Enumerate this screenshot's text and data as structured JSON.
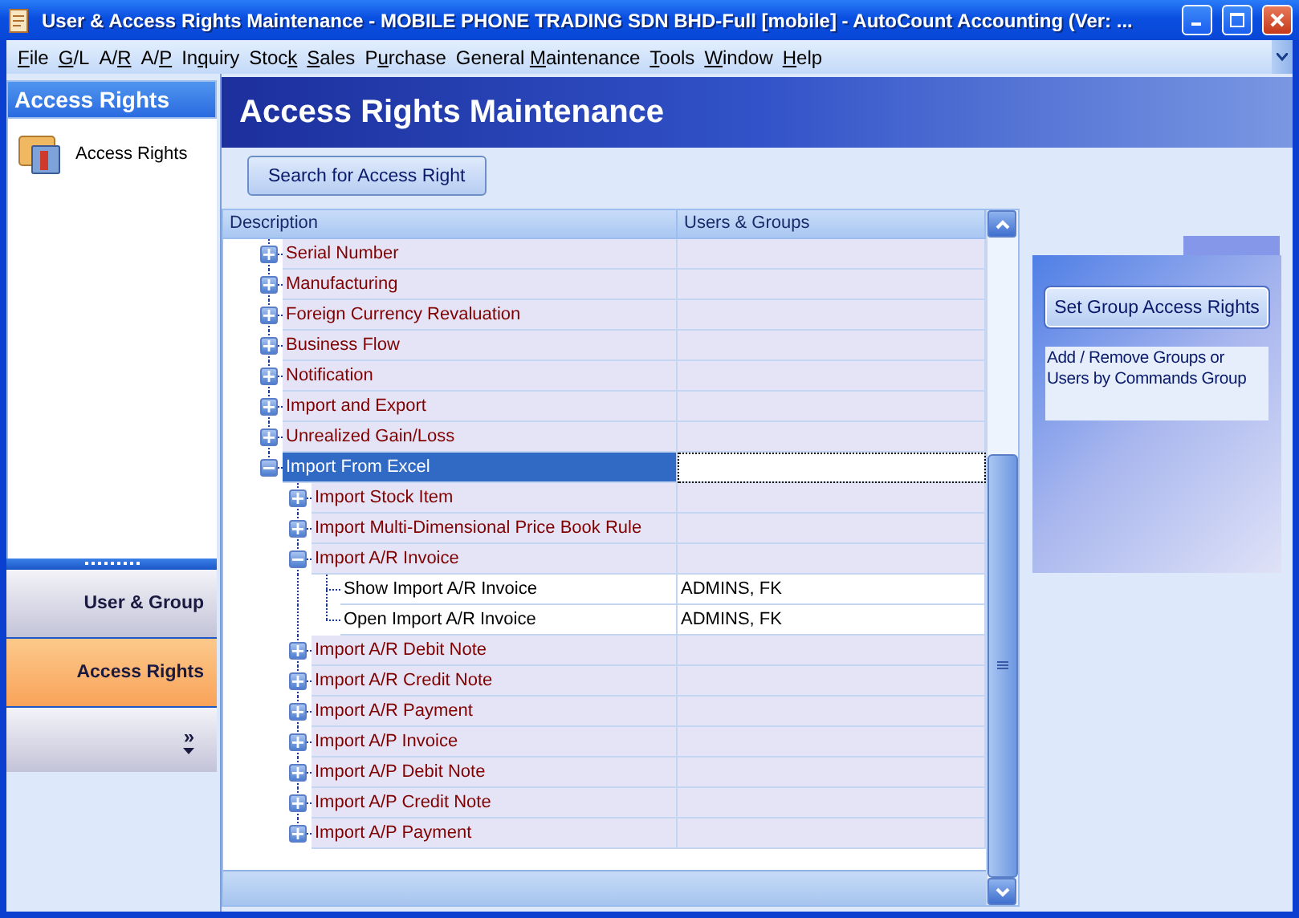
{
  "window": {
    "title": "User & Access Rights Maintenance - MOBILE PHONE TRADING SDN  BHD-Full [mobile] - AutoCount Accounting (Ver: ..."
  },
  "menu": [
    {
      "key": "F",
      "post": "ile"
    },
    {
      "key": "G",
      "post": "/L"
    },
    {
      "pre": "A/",
      "key": "R"
    },
    {
      "pre": "A/",
      "key": "P"
    },
    {
      "pre": "In",
      "key": "q",
      "post": "uiry"
    },
    {
      "pre": "Stoc",
      "key": "k"
    },
    {
      "key": "S",
      "post": "ales"
    },
    {
      "pre": "P",
      "key": "u",
      "post": "rchase"
    },
    {
      "pre": "General ",
      "key": "M",
      "post": "aintenance"
    },
    {
      "key": "T",
      "post": "ools"
    },
    {
      "key": "W",
      "post": "indow"
    },
    {
      "key": "H",
      "post": "elp"
    }
  ],
  "sidebar": {
    "title": "Access Rights",
    "items": [
      {
        "label": "Access Rights"
      }
    ],
    "nav_buttons": [
      {
        "label": "User & Group",
        "selected": false
      },
      {
        "label": "Access Rights",
        "selected": true
      }
    ],
    "overflow": "»"
  },
  "header": {
    "title": "Access Rights Maintenance"
  },
  "search_button": "Search for Access Right",
  "tree": {
    "columns": [
      "Description",
      "Users & Groups"
    ],
    "rows": [
      {
        "kind": "group",
        "label": "Serial Number",
        "expanded": false,
        "selected": false
      },
      {
        "kind": "group",
        "label": "Manufacturing",
        "expanded": false,
        "selected": false
      },
      {
        "kind": "group",
        "label": "Foreign Currency Revaluation",
        "expanded": false,
        "selected": false
      },
      {
        "kind": "group",
        "label": "Business Flow",
        "expanded": false,
        "selected": false
      },
      {
        "kind": "group",
        "label": "Notification",
        "expanded": false,
        "selected": false
      },
      {
        "kind": "group",
        "label": "Import and Export",
        "expanded": false,
        "selected": false
      },
      {
        "kind": "group",
        "label": "Unrealized Gain/Loss",
        "expanded": false,
        "selected": false
      },
      {
        "kind": "group",
        "label": "Import From Excel",
        "expanded": true,
        "selected": true,
        "children": [
          {
            "kind": "group",
            "label": "Import Stock Item",
            "expanded": false,
            "selected": false
          },
          {
            "kind": "group",
            "label": "Import Multi-Dimensional Price Book Rule",
            "expanded": false,
            "selected": false
          },
          {
            "kind": "group",
            "label": "Import A/R Invoice",
            "expanded": true,
            "selected": false,
            "children": [
              {
                "kind": "leaf",
                "label": "Show Import A/R Invoice",
                "users": "ADMINS, FK",
                "selected": false
              },
              {
                "kind": "leaf",
                "label": "Open Import A/R Invoice",
                "users": "ADMINS, FK",
                "selected": false
              }
            ]
          },
          {
            "kind": "group",
            "label": "Import A/R Debit Note",
            "expanded": false,
            "selected": false
          },
          {
            "kind": "group",
            "label": "Import A/R Credit Note",
            "expanded": false,
            "selected": false
          },
          {
            "kind": "group",
            "label": "Import A/R Payment",
            "expanded": false,
            "selected": false
          },
          {
            "kind": "group",
            "label": "Import A/P Invoice",
            "expanded": false,
            "selected": false
          },
          {
            "kind": "group",
            "label": "Import A/P Debit Note",
            "expanded": false,
            "selected": false
          },
          {
            "kind": "group",
            "label": "Import A/P Credit Note",
            "expanded": false,
            "selected": false
          },
          {
            "kind": "group",
            "label": "Import A/P Payment",
            "expanded": false,
            "selected": false
          }
        ]
      }
    ]
  },
  "side_panel": {
    "button": "Set Group Access Rights",
    "description": "Add / Remove Groups or Users by Commands Group"
  }
}
